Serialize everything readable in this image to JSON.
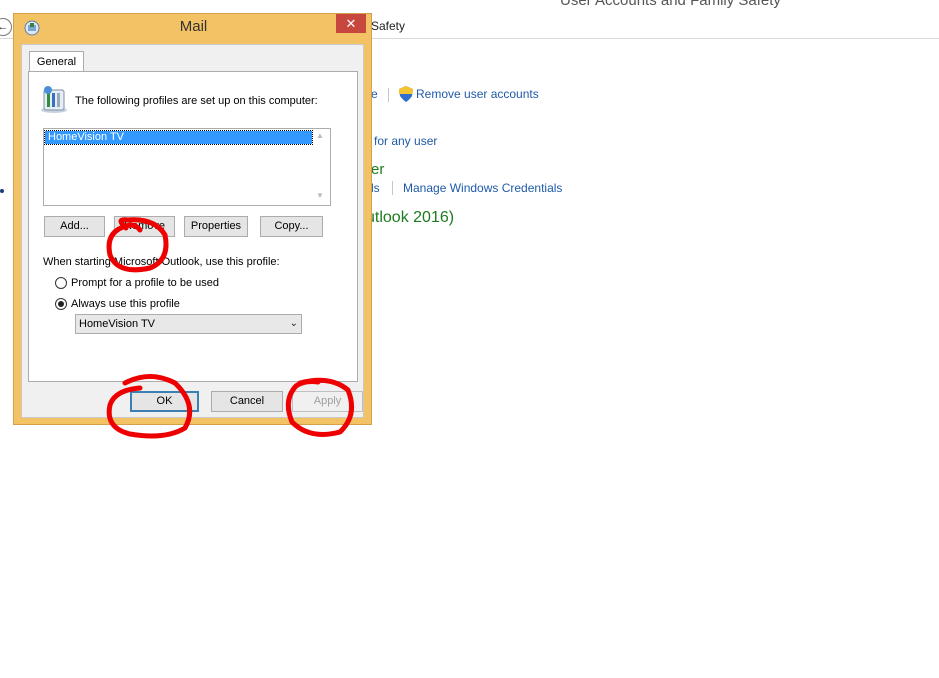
{
  "background": {
    "title": "User Accounts and Family Safety",
    "breadcrumb": "Safety",
    "links": {
      "partial_left": "e",
      "remove_user_accounts": "Remove user accounts",
      "for_any_user": "for any user",
      "partial_ls": "ls",
      "manage_credentials": "Manage Windows Credentials"
    },
    "headings": {
      "partial_er": "er",
      "partial_outlook": "utlook 2016)"
    }
  },
  "dialog": {
    "title": "Mail",
    "close_label": "✕",
    "tab_general": "General",
    "profiles_label": "The following profiles are set up on this computer:",
    "profiles": [
      "HomeVision TV"
    ],
    "buttons": {
      "add": "Add...",
      "remove": "Remove",
      "properties": "Properties",
      "copy": "Copy..."
    },
    "startup_label": "When starting Microsoft Outlook, use this profile:",
    "radio_prompt": "Prompt for a profile to be used",
    "radio_always": "Always use this profile",
    "selected_radio": "always",
    "profile_select_value": "HomeVision TV",
    "footer": {
      "ok": "OK",
      "cancel": "Cancel",
      "apply": "Apply"
    }
  },
  "colors": {
    "dialog_frame": "#f3c265",
    "close_button": "#c7463d",
    "selection": "#3399ff",
    "link": "#1e5aa8",
    "heading": "#1e7a1e",
    "annotation": "#ee0000"
  }
}
